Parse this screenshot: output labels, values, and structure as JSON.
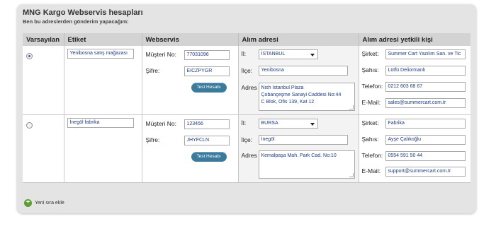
{
  "header": {
    "title": "MNG Kargo Webservis hesapları",
    "subtitle": "Ben bu adreslerden gönderim yapacağım:"
  },
  "columns": [
    "Varsayılan",
    "Etiket",
    "Webservis",
    "Alım adresi",
    "Alım adresi yetkili kişi"
  ],
  "labels": {
    "customer_no": "Müşteri No:",
    "password": "Şifre:",
    "test_button": "Test Hesabı",
    "city": "İl:",
    "district": "İlçe:",
    "address": "Adres",
    "company": "Şirket:",
    "person": "Şahıs:",
    "phone": "Telefon:",
    "email": "E-Mail:"
  },
  "rows": [
    {
      "default_selected": true,
      "label": "Yenibosna satış mağazası",
      "customer_no": "77031096",
      "password": "EICZPYGR",
      "city": "İSTANBUL",
      "district": "Yenibosna",
      "address_lines": [
        "Nish İstanbul Plaza",
        "Çobançeşme Sanayi Caddesi No:44",
        "C Blok, Ofis 139, Kat 12"
      ],
      "company": "Summer Cart Yazılım San. ve Tic",
      "person": "Lütfü Deliormanlı",
      "phone": "0212 603 68 67",
      "email": "sales@summercart.com.tr"
    },
    {
      "default_selected": false,
      "label": "İnegöl fabrika",
      "customer_no": "123456",
      "password": "JHYFCLN",
      "city": "BURSA",
      "district": "İnegöl",
      "address_lines": [
        "Kemalpaşa Mah. Park Cad. No:10"
      ],
      "company": "Fabrika",
      "person": "Ayşe Çalıkoğlu",
      "phone": "0554 591 50 44",
      "email": "support@summercart.com.tr"
    }
  ],
  "add_row": {
    "label": "Yeni sıra ekle",
    "icon": "plus-icon"
  },
  "colors": {
    "button": "#3a7a9a",
    "add_icon": "#5aa02c",
    "header_bg": "#d3d3d3",
    "frame_bg": "#e4e4e4"
  }
}
